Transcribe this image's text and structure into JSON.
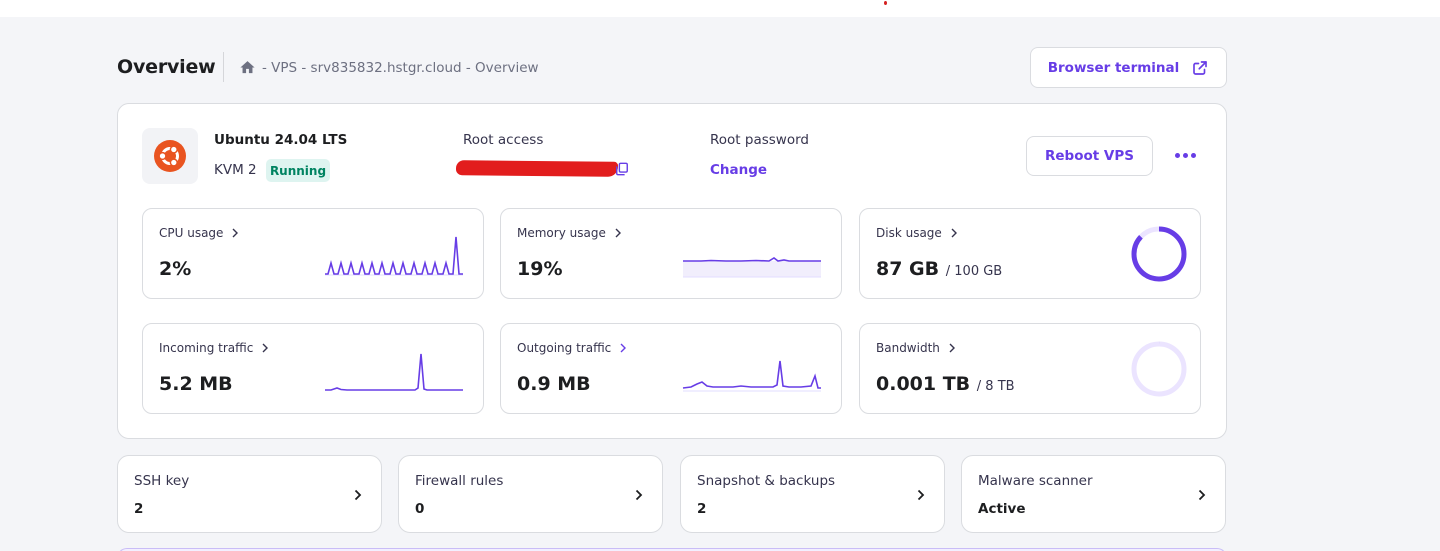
{
  "header": {
    "title": "Overview",
    "breadcrumb": "- VPS - srv835832.hstgr.cloud - Overview",
    "terminal_button": "Browser terminal"
  },
  "server": {
    "os": "Ubuntu 24.04 LTS",
    "plan": "KVM 2",
    "status": "Running",
    "root_access_label": "Root access",
    "root_password_label": "Root password",
    "change_link": "Change",
    "reboot_button": "Reboot VPS"
  },
  "metrics": {
    "cpu": {
      "label": "CPU usage",
      "value": "2%"
    },
    "memory": {
      "label": "Memory usage",
      "value": "19%"
    },
    "disk": {
      "label": "Disk usage",
      "value": "87 GB",
      "total": "/ 100 GB",
      "fraction": 0.87
    },
    "incoming": {
      "label": "Incoming traffic",
      "value": "5.2 MB"
    },
    "outgoing": {
      "label": "Outgoing traffic",
      "value": "0.9 MB"
    },
    "bandwidth": {
      "label": "Bandwidth",
      "value": "0.001 TB",
      "total": "/ 8 TB",
      "fraction": 0.000125
    }
  },
  "quick": [
    {
      "title": "SSH key",
      "value": "2"
    },
    {
      "title": "Firewall rules",
      "value": "0"
    },
    {
      "title": "Snapshot & backups",
      "value": "2"
    },
    {
      "title": "Malware scanner",
      "value": "Active"
    }
  ],
  "colors": {
    "accent": "#673de6",
    "running_bg": "#def4f0",
    "running_text": "#008361",
    "ubuntu": "#e95420"
  },
  "icons": {
    "breadcrumb": "home-icon",
    "terminal": "external-link-icon",
    "os": "ubuntu-logo-icon",
    "copy": "copy-icon",
    "more": "more-dots-icon",
    "chevron": "chevron-right-icon"
  }
}
